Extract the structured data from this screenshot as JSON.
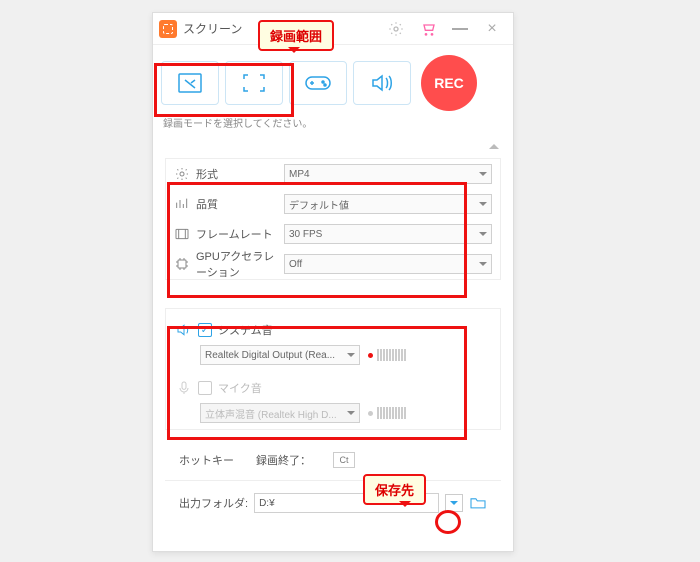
{
  "title": "スクリーン",
  "callouts": {
    "recordArea": "録画範囲",
    "saveLoc": "保存先"
  },
  "modeHint": "録画モードを選択してください。",
  "recLabel": "REC",
  "settings": {
    "format": {
      "label": "形式",
      "value": "MP4"
    },
    "quality": {
      "label": "品質",
      "value": "デフォルト値"
    },
    "framerate": {
      "label": "フレームレート",
      "value": "30 FPS"
    },
    "gpu": {
      "label": "GPUアクセラレーション",
      "value": "Off"
    }
  },
  "audio": {
    "system": {
      "label": "システム音",
      "device": "Realtek Digital Output (Rea...",
      "checked": true
    },
    "mic": {
      "label": "マイク音",
      "device": "立体声混音 (Realtek High D...",
      "checked": false
    }
  },
  "hotkey": {
    "label": "ホットキー",
    "stop": "録画終了：",
    "key": "Ct"
  },
  "output": {
    "label": "出力フォルダ:",
    "path": "D:¥"
  }
}
